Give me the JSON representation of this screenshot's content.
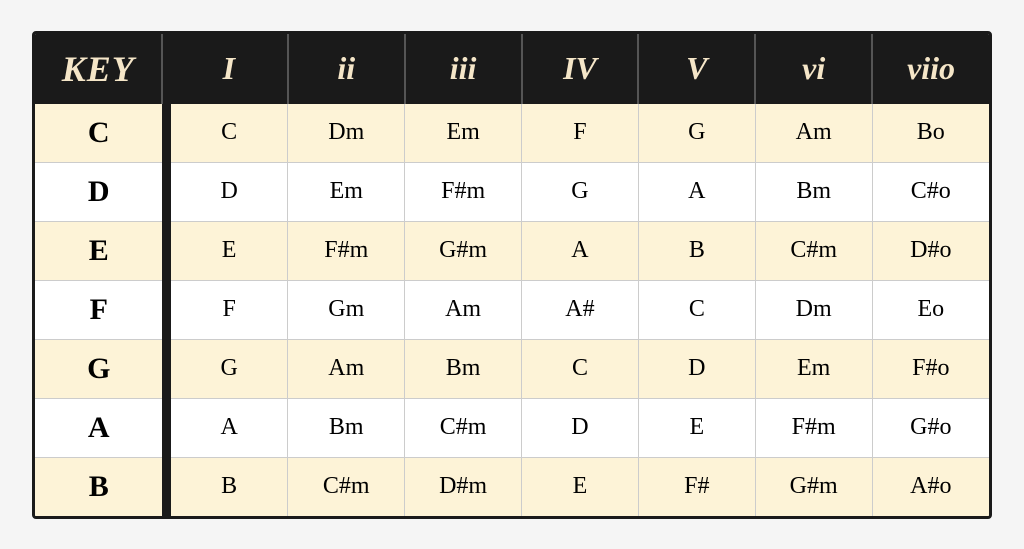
{
  "header": {
    "key_label": "KEY",
    "col_I": "I",
    "col_ii": "ii",
    "col_iii": "iii",
    "col_IV": "IV",
    "col_V": "V",
    "col_vi": "vi",
    "col_viio": "viio"
  },
  "rows": [
    {
      "key": "C",
      "I": "C",
      "ii": "Dm",
      "iii": "Em",
      "IV": "F",
      "V": "G",
      "vi": "Am",
      "viio": "Bo"
    },
    {
      "key": "D",
      "I": "D",
      "ii": "Em",
      "iii": "F#m",
      "IV": "G",
      "V": "A",
      "vi": "Bm",
      "viio": "C#o"
    },
    {
      "key": "E",
      "I": "E",
      "ii": "F#m",
      "iii": "G#m",
      "IV": "A",
      "V": "B",
      "vi": "C#m",
      "viio": "D#o"
    },
    {
      "key": "F",
      "I": "F",
      "ii": "Gm",
      "iii": "Am",
      "IV": "A#",
      "V": "C",
      "vi": "Dm",
      "viio": "Eo"
    },
    {
      "key": "G",
      "I": "G",
      "ii": "Am",
      "iii": "Bm",
      "IV": "C",
      "V": "D",
      "vi": "Em",
      "viio": "F#o"
    },
    {
      "key": "A",
      "I": "A",
      "ii": "Bm",
      "iii": "C#m",
      "IV": "D",
      "V": "E",
      "vi": "F#m",
      "viio": "G#o"
    },
    {
      "key": "B",
      "I": "B",
      "ii": "C#m",
      "iii": "D#m",
      "IV": "E",
      "V": "F#",
      "vi": "G#m",
      "viio": "A#o"
    }
  ]
}
